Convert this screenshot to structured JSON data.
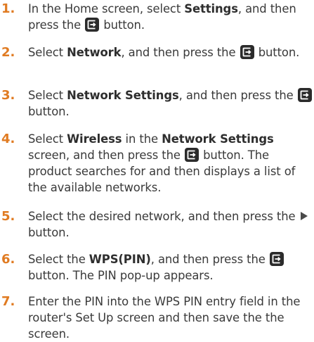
{
  "steps": [
    {
      "number": "1.",
      "text1": "In the Home screen, select ",
      "bold1": "Settings",
      "text2": ", and then press the ",
      "text3": " button."
    },
    {
      "number": "2.",
      "text1": "Select ",
      "bold1": "Network",
      "text2": ", and then press the ",
      "text3": " button."
    },
    {
      "number": "3.",
      "text1": "Select ",
      "bold1": "Network Settings",
      "text2": ", and then press the ",
      "text3": " button."
    },
    {
      "number": "4.",
      "text1": "Select ",
      "bold1": "Wireless",
      "text2": " in the ",
      "bold2": "Network Settings",
      "text3": " screen, and then press the ",
      "text4": " button. The product searches for and then displays a list of the available networks."
    },
    {
      "number": "5.",
      "text1": "Select the desired network, and then press the ",
      "text2": " button."
    },
    {
      "number": "6.",
      "text1": "Select the ",
      "bold1": "WPS(PIN)",
      "text2": ", and then press the ",
      "text3": " button. The PIN pop-up appears."
    },
    {
      "number": "7.",
      "text1": "Enter the PIN into the WPS PIN entry field in the router's Set Up screen and then save the the screen."
    }
  ],
  "icons": {
    "enter": "enter-button-icon",
    "play": "play-button-icon"
  },
  "colors": {
    "step_number": "#e07b22",
    "text": "#3a3a3a",
    "icon_bg": "#2b2b2b"
  }
}
